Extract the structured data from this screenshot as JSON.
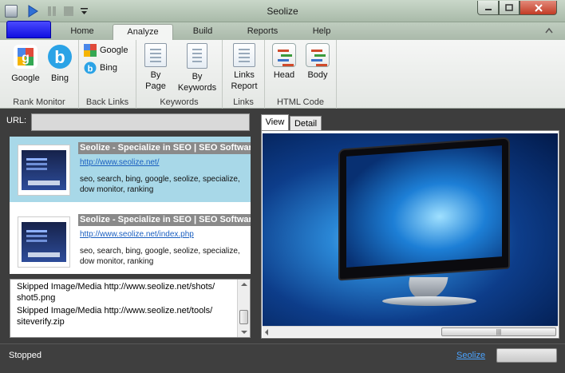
{
  "window": {
    "title": "Seolize"
  },
  "tabs": {
    "home": "Home",
    "analyze": "Analyze",
    "build": "Build",
    "reports": "Reports",
    "help": "Help"
  },
  "ribbon": {
    "rank_monitor": {
      "label": "Rank Monitor",
      "google": "Google",
      "bing": "Bing"
    },
    "back_links": {
      "label": "Back Links",
      "google": "Google",
      "bing": "Bing"
    },
    "keywords": {
      "label": "Keywords",
      "by_page_1": "By",
      "by_page_2": "Page",
      "by_keywords_1": "By",
      "by_keywords_2": "Keywords"
    },
    "links": {
      "label": "Links",
      "links_report_1": "Links",
      "links_report_2": "Report"
    },
    "html_code": {
      "label": "HTML Code",
      "head": "Head",
      "body": "Body"
    }
  },
  "url_bar": {
    "label": "URL:",
    "value": ""
  },
  "results": [
    {
      "title": "Seolize - Specialize in SEO | SEO Software",
      "url": "http://www.seolize.net/",
      "keywords": "seo, search, bing, google, seolize, specialize, dow monitor, ranking"
    },
    {
      "title": "Seolize - Specialize in SEO | SEO Software",
      "url": "http://www.seolize.net/index.php",
      "keywords": "seo, search, bing, google, seolize, specialize, dow monitor, ranking"
    }
  ],
  "log": [
    "Skipped Image/Media http://www.seolize.net/shots/ shot5.png",
    "Skipped Image/Media http://www.seolize.net/tools/ siteverify.zip"
  ],
  "view_tabs": {
    "view": "View",
    "detail": "Detail"
  },
  "status": {
    "text": "Stopped",
    "link": "Seolize",
    "progress": 0
  },
  "icons": {
    "app_button_color": "#1818e8",
    "selection_color": "#a8d8e8"
  }
}
